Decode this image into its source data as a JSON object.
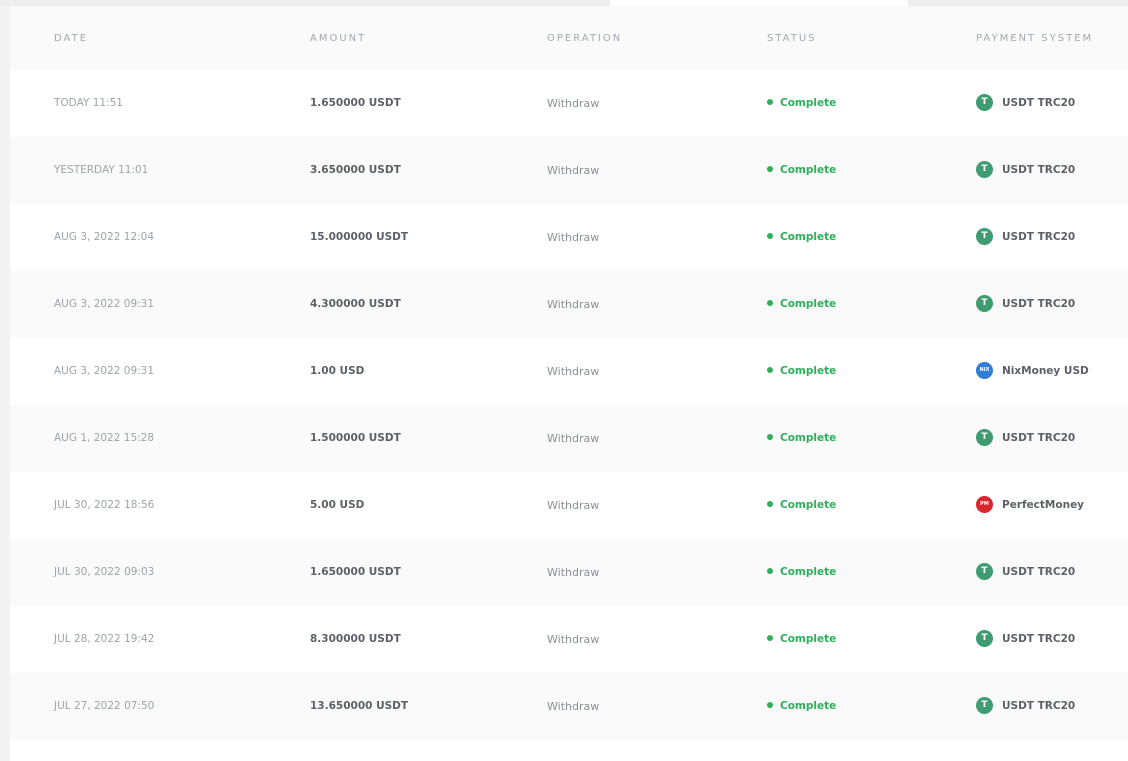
{
  "header": {
    "date": "DATE",
    "amount": "AMOUNT",
    "operation": "OPERATION",
    "status": "STATUS",
    "payment_system": "PAYMENT SYSTEM"
  },
  "rows": [
    {
      "date": "TODAY 11:51",
      "amount": "1.650000 USDT",
      "operation": "Withdraw",
      "status": "Complete",
      "payment": "USDT TRC20",
      "icon": "usdt-icon",
      "icon_text": "T"
    },
    {
      "date": "YESTERDAY 11:01",
      "amount": "3.650000 USDT",
      "operation": "Withdraw",
      "status": "Complete",
      "payment": "USDT TRC20",
      "icon": "usdt-icon",
      "icon_text": "T"
    },
    {
      "date": "AUG 3, 2022 12:04",
      "amount": "15.000000 USDT",
      "operation": "Withdraw",
      "status": "Complete",
      "payment": "USDT TRC20",
      "icon": "usdt-icon",
      "icon_text": "T"
    },
    {
      "date": "AUG 3, 2022 09:31",
      "amount": "4.300000 USDT",
      "operation": "Withdraw",
      "status": "Complete",
      "payment": "USDT TRC20",
      "icon": "usdt-icon",
      "icon_text": "T"
    },
    {
      "date": "AUG 3, 2022 09:31",
      "amount": "1.00 USD",
      "operation": "Withdraw",
      "status": "Complete",
      "payment": "NixMoney USD",
      "icon": "nixmoney-icon",
      "icon_text": "NIX"
    },
    {
      "date": "AUG 1, 2022 15:28",
      "amount": "1.500000 USDT",
      "operation": "Withdraw",
      "status": "Complete",
      "payment": "USDT TRC20",
      "icon": "usdt-icon",
      "icon_text": "T"
    },
    {
      "date": "JUL 30, 2022 18:56",
      "amount": "5.00 USD",
      "operation": "Withdraw",
      "status": "Complete",
      "payment": "PerfectMoney",
      "icon": "perfectmoney-icon",
      "icon_text": "PM"
    },
    {
      "date": "JUL 30, 2022 09:03",
      "amount": "1.650000 USDT",
      "operation": "Withdraw",
      "status": "Complete",
      "payment": "USDT TRC20",
      "icon": "usdt-icon",
      "icon_text": "T"
    },
    {
      "date": "JUL 28, 2022 19:42",
      "amount": "8.300000 USDT",
      "operation": "Withdraw",
      "status": "Complete",
      "payment": "USDT TRC20",
      "icon": "usdt-icon",
      "icon_text": "T"
    },
    {
      "date": "JUL 27, 2022 07:50",
      "amount": "13.650000 USDT",
      "operation": "Withdraw",
      "status": "Complete",
      "payment": "USDT TRC20",
      "icon": "usdt-icon",
      "icon_text": "T"
    }
  ],
  "colors": {
    "status_complete": "#2fae5b",
    "usdt": "#3e9b72",
    "nixmoney": "#2f7ed8",
    "perfectmoney": "#d9262d"
  }
}
